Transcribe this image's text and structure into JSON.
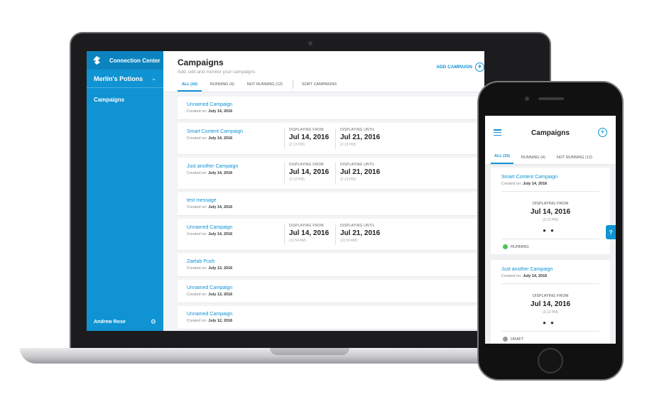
{
  "colors": {
    "accent": "#0f93d2",
    "running": "#4cc35a",
    "draft": "#9b9b9b"
  },
  "laptop": {
    "sidebar": {
      "app_name": "Connection Center",
      "logo_icon": "connection-logo-icon",
      "account_name": "Merlin's Potions",
      "nav_items": [
        {
          "label": "Campaigns"
        }
      ],
      "user_name": "Andrew Rose",
      "settings_icon": "gear-icon"
    },
    "header": {
      "title": "Campaigns",
      "subtitle": "Add, edit and monitor your campaigns",
      "add_button": "ADD CAMPAIGN",
      "tabs": [
        {
          "label": "ALL (16)",
          "active": true
        },
        {
          "label": "RUNNING (4)",
          "active": false
        },
        {
          "label": "NOT RUNNING (12)",
          "active": false
        }
      ],
      "sort_label": "SORT CAMPAIGNS"
    },
    "campaigns": [
      {
        "name": "Unnamed Campaign",
        "created_label": "Created on:",
        "created": "July 14, 2016"
      },
      {
        "name": "Smart Content Campaign",
        "created_label": "Created on:",
        "created": "July 14, 2016",
        "from_label": "DISPLAYING FROM",
        "from_date": "Jul 14, 2016",
        "from_time": "(2:13 PM)",
        "until_label": "DISPLAYING UNTIL",
        "until_date": "Jul 21, 2016",
        "until_time": "(2:13 PM)"
      },
      {
        "name": "Just another Campaign",
        "created_label": "Created on:",
        "created": "July 14, 2016",
        "from_label": "DISPLAYING FROM",
        "from_date": "Jul 14, 2016",
        "from_time": "(2:12 PM)",
        "until_label": "DISPLAYING UNTIL",
        "until_date": "Jul 21, 2016",
        "until_time": "(2:13 PM)"
      },
      {
        "name": "test message",
        "created_label": "Created on:",
        "created": "July 14, 2016"
      },
      {
        "name": "Unnamed Campaign",
        "created_label": "Created on:",
        "created": "July 14, 2016",
        "from_label": "DISPLAYING FROM",
        "from_date": "Jul 14, 2016",
        "from_time": "(11:54 AM)",
        "until_label": "DISPLAYING UNTIL",
        "until_date": "Jul 21, 2016",
        "until_time": "(11:54 AM)"
      },
      {
        "name": "Zaelab Push",
        "created_label": "Created on:",
        "created": "July 13, 2016"
      },
      {
        "name": "Unnamed Campaign",
        "created_label": "Created on:",
        "created": "July 13, 2016"
      },
      {
        "name": "Unnamed Campaign",
        "created_label": "Created on:",
        "created": "July 12, 2016"
      }
    ]
  },
  "phone": {
    "menu_icon": "hamburger-menu-icon",
    "title": "Campaigns",
    "add_icon": "plus-circle-icon",
    "tabs": [
      {
        "label": "ALL (16)",
        "active": true
      },
      {
        "label": "RUNNING (4)",
        "active": false
      },
      {
        "label": "NOT RUNNING (12)",
        "active": false
      }
    ],
    "help_label": "?",
    "campaigns": [
      {
        "name": "Smart Content Campaign",
        "created_label": "Created on:",
        "created": "July 14, 2016",
        "label": "DISPLAYING FROM",
        "date": "Jul 14, 2016",
        "time": "(2:13 PM)",
        "dots": "●●",
        "status": "RUNNING",
        "status_color": "#4cc35a"
      },
      {
        "name": "Just another Campaign",
        "created_label": "Created on:",
        "created": "July 14, 2016",
        "label": "DISPLAYING FROM",
        "date": "Jul 14, 2016",
        "time": "(2:12 PM)",
        "dots": "●●",
        "status": "DRAFT",
        "status_color": "#9b9b9b"
      }
    ]
  }
}
